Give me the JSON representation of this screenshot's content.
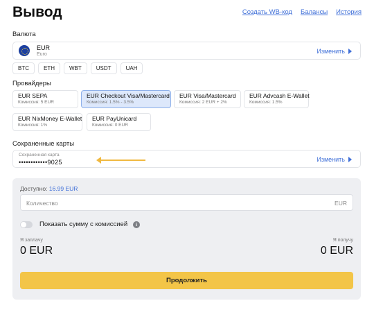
{
  "header": {
    "title": "Вывод",
    "links": [
      "Создать WB-код",
      "Балансы",
      "История"
    ]
  },
  "currency": {
    "label": "Валюта",
    "code": "EUR",
    "name": "Euro",
    "change_label": "Изменить",
    "chips": [
      "BTC",
      "ETH",
      "WBT",
      "USDT",
      "UAH"
    ]
  },
  "providers": {
    "label": "Провайдеры",
    "items": [
      {
        "name": "EUR SEPA",
        "fee": "Комиссия: 5 EUR",
        "selected": false
      },
      {
        "name": "EUR Checkout Visa/Mastercard",
        "fee": "Комиссия: 1.5% - 3.5%",
        "selected": true
      },
      {
        "name": "EUR Visa/Mastercard",
        "fee": "Комиссия: 2 EUR + 2%",
        "selected": false
      },
      {
        "name": "EUR Advcash E-Wallet",
        "fee": "Комиссия: 1.5%",
        "selected": false
      },
      {
        "name": "EUR NixMoney E-Wallet",
        "fee": "Комиссия: 1%",
        "selected": false
      },
      {
        "name": "EUR PayUnicard",
        "fee": "Комиссия: 0 EUR",
        "selected": false
      }
    ]
  },
  "saved_cards": {
    "label": "Сохраненные карты",
    "caption": "Сохраненная карта",
    "number": "••••••••••••9025",
    "change_label": "Изменить"
  },
  "form": {
    "available_label": "Доступно:",
    "available_amount": "16.99 EUR",
    "amount_placeholder": "Количество",
    "amount_currency": "EUR",
    "toggle_label": "Показать сумму с комиссией",
    "toggle_on": false,
    "pay_label": "Я заплачу",
    "pay_value": "0 EUR",
    "receive_label": "Я получу",
    "receive_value": "0 EUR",
    "continue_label": "Продолжить"
  },
  "colors": {
    "accent": "#3f6fd8",
    "button": "#f3c548",
    "arrow": "#f0b941",
    "selected_bg": "#dde8fb"
  }
}
